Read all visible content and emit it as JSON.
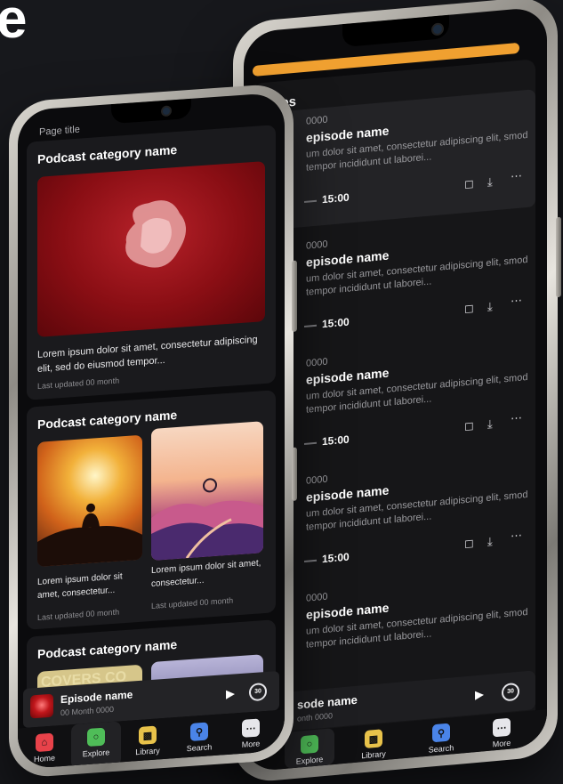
{
  "hero_letter": "e",
  "colors": {
    "home": "#e8424a",
    "explore": "#4fbd58",
    "library": "#e8c24a",
    "search": "#4a84e8",
    "more": "#e6e6ea",
    "accent_orange": "#f0a030"
  },
  "back_phone": {
    "section_header": "odes",
    "episodes": [
      {
        "date": "0000",
        "title": "episode name",
        "desc": "um dolor sit amet, consectetur adipiscing elit, smod tempor incididunt ut laborei...",
        "duration": "15:00"
      },
      {
        "date": "0000",
        "title": "episode name",
        "desc": "um dolor sit amet, consectetur adipiscing elit, smod tempor incididunt ut laborei...",
        "duration": "15:00"
      },
      {
        "date": "0000",
        "title": "episode name",
        "desc": "um dolor sit amet, consectetur adipiscing elit, smod tempor incididunt ut laborei...",
        "duration": "15:00"
      },
      {
        "date": "0000",
        "title": "episode name",
        "desc": "um dolor sit amet, consectetur adipiscing elit, smod tempor incididunt ut laborei...",
        "duration": "15:00"
      },
      {
        "date": "0000",
        "title": "episode name",
        "desc": "um dolor sit amet, consectetur adipiscing elit, smod tempor incididunt ut laborei...",
        "duration": ""
      }
    ],
    "mini_player": {
      "title": "sode name",
      "subtitle": "onth 0000",
      "skip_label": "30"
    },
    "nav": {
      "explore": "Explore",
      "library": "Library",
      "search": "Search",
      "more": "More"
    }
  },
  "front_phone": {
    "page_title": "Page title",
    "sections": [
      {
        "title": "Podcast category name",
        "text": "Lorem ipsum dolor sit amet, consectetur adipiscing elit, sed do eiusmod tempor...",
        "meta": "Last updated 00 month"
      },
      {
        "title": "Podcast category name",
        "items": [
          {
            "text": "Lorem ipsum dolor sit amet, consectetur...",
            "meta": "Last updated 00 month"
          },
          {
            "text": "Lorem ipsum dolor sit amet, consectetur...",
            "meta": "Last updated 00 month"
          }
        ]
      },
      {
        "title": "Podcast category name",
        "cover_text": "COVERS CO"
      }
    ],
    "mini_player": {
      "title": "Episode name",
      "subtitle": "00 Month 0000",
      "skip_label": "30"
    },
    "nav": {
      "home": "Home",
      "explore": "Explore",
      "library": "Library",
      "search": "Search",
      "more": "More"
    }
  }
}
